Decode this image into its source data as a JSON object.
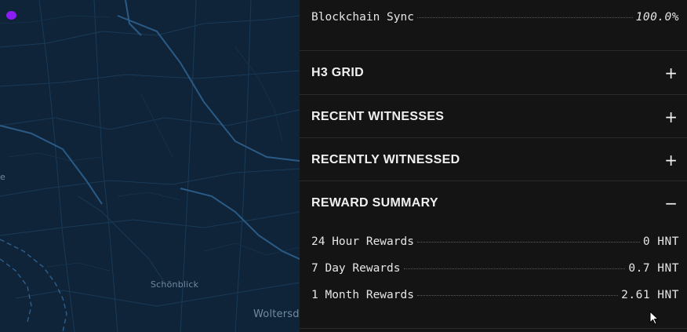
{
  "map": {
    "labels": [
      "Schönblick",
      "Woltersd",
      "e"
    ],
    "hotspot_color": "#8a1df2"
  },
  "panel": {
    "sync": {
      "label": "Blockchain Sync",
      "value": "100.0%"
    },
    "sections": [
      {
        "title": "H3 GRID",
        "toggle": "+"
      },
      {
        "title": "RECENT WITNESSES",
        "toggle": "+"
      },
      {
        "title": "RECENTLY WITNESSED",
        "toggle": "+"
      },
      {
        "title": "REWARD SUMMARY",
        "toggle": "−"
      }
    ],
    "rewards": [
      {
        "label": "24 Hour Rewards",
        "value": "0 HNT"
      },
      {
        "label": "7 Day Rewards",
        "value": "0.7 HNT"
      },
      {
        "label": "1 Month Rewards",
        "value": "2.61 HNT"
      }
    ]
  }
}
